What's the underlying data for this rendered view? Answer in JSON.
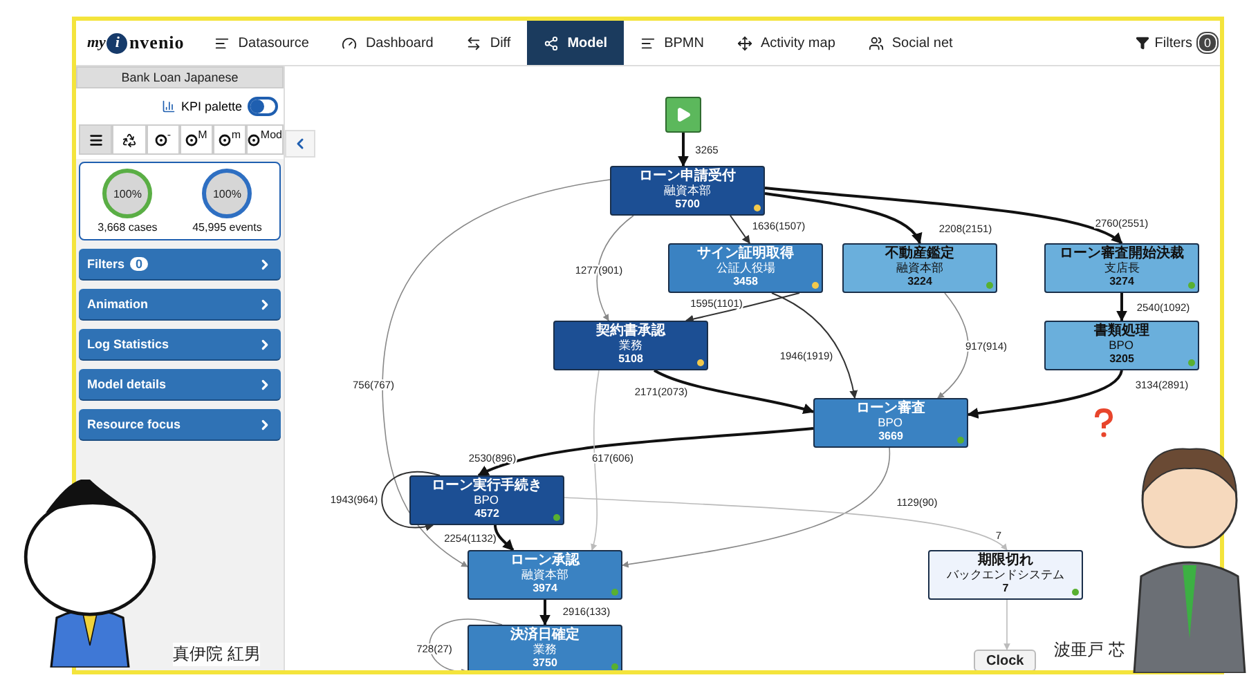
{
  "app": {
    "logo": [
      "my",
      "i",
      "nvenio"
    ]
  },
  "nav": [
    {
      "label": "Datasource",
      "kind": "list",
      "selected": false
    },
    {
      "label": "Dashboard",
      "kind": "gauge",
      "selected": false
    },
    {
      "label": "Diff",
      "kind": "swap",
      "selected": false
    },
    {
      "label": "Model",
      "kind": "model",
      "selected": true
    },
    {
      "label": "BPMN",
      "kind": "list",
      "selected": false
    },
    {
      "label": "Activity map",
      "kind": "move",
      "selected": false
    },
    {
      "label": "Social net",
      "kind": "users",
      "selected": false
    }
  ],
  "filters": {
    "label": "Filters",
    "count": "0"
  },
  "sidebar": {
    "title": "Bank Loan Japanese",
    "kpi_palette": {
      "label": "KPI palette",
      "on": false
    },
    "tools": [
      {
        "kind": "menu",
        "selected": true
      },
      {
        "kind": "recycle",
        "selected": false
      },
      {
        "kind": "dial",
        "label": "-",
        "selected": false
      },
      {
        "kind": "dial",
        "label": "M",
        "selected": false
      },
      {
        "kind": "dial",
        "label": "m",
        "selected": false
      },
      {
        "kind": "dial",
        "label": "Mod",
        "selected": false
      }
    ],
    "stats": [
      {
        "percent": "100%",
        "caption": "3,668 cases",
        "color": "#5aae45"
      },
      {
        "percent": "100%",
        "caption": "45,995 events",
        "color": "#2e6fc2"
      }
    ],
    "panels": [
      {
        "label": "Filters",
        "badge": "0"
      },
      {
        "label": "Animation"
      },
      {
        "label": "Log Statistics"
      },
      {
        "label": "Model details"
      },
      {
        "label": "Resource focus"
      }
    ]
  },
  "process_map": {
    "nodes": [
      {
        "title": "ローン申請受付",
        "resource": "融資本部",
        "count": "5700",
        "kind": "dark",
        "color": "#f2c94c"
      },
      {
        "title": "サイン証明取得",
        "resource": "公証人役場",
        "count": "3458",
        "kind": "medium",
        "color": "#f2c94c"
      },
      {
        "title": "不動産鑑定",
        "resource": "融資本部",
        "count": "3224",
        "kind": "light",
        "color": "#58b030"
      },
      {
        "title": "ローン審査開始決裁",
        "resource": "支店長",
        "count": "3274",
        "kind": "light",
        "color": "#58b030"
      },
      {
        "title": "契約書承認",
        "resource": "業務",
        "count": "5108",
        "kind": "dark",
        "color": "#f2c94c"
      },
      {
        "title": "書類処理",
        "resource": "BPO",
        "count": "3205",
        "kind": "light",
        "color": "#58b030"
      },
      {
        "title": "ローン審査",
        "resource": "BPO",
        "count": "3669",
        "kind": "medium",
        "color": "#58b030"
      },
      {
        "title": "ローン実行手続き",
        "resource": "BPO",
        "count": "4572",
        "kind": "dark",
        "color": "#58b030"
      },
      {
        "title": "ローン承認",
        "resource": "融資本部",
        "count": "3974",
        "kind": "medium",
        "color": "#58b030"
      },
      {
        "title": "期限切れ",
        "resource": "バックエンドシステム",
        "count": "7",
        "kind": "pale",
        "color": "#58b030"
      },
      {
        "title": "決済日確定",
        "resource": "業務",
        "count": "3750",
        "kind": "medium",
        "color": "#58b030"
      }
    ],
    "edges": [
      {
        "label": "3265",
        "kind": "strong"
      },
      {
        "label": "1636(1507)",
        "kind": "normal"
      },
      {
        "label": "2208(2151)",
        "kind": "strong"
      },
      {
        "label": "2760(2551)",
        "kind": "strong"
      },
      {
        "label": "1277(901)",
        "kind": "weak"
      },
      {
        "label": "1595(1101)",
        "kind": "normal"
      },
      {
        "label": "1946(1919)",
        "kind": "normal"
      },
      {
        "label": "917(914)",
        "kind": "weak"
      },
      {
        "label": "2540(1092)",
        "kind": "strong"
      },
      {
        "label": "2171(2073)",
        "kind": "strong"
      },
      {
        "label": "3134(2891)",
        "kind": "strong"
      },
      {
        "label": "756(767)",
        "kind": "weak"
      },
      {
        "label": "2530(896)",
        "kind": "strong"
      },
      {
        "label": "617(606)",
        "kind": "faint"
      },
      {
        "label": "1943(964)",
        "kind": "normal"
      },
      {
        "label": "2254(1132)",
        "kind": "strong"
      },
      {
        "label": "1129(90)",
        "kind": "weak"
      },
      {
        "label": "7",
        "kind": "faint"
      },
      {
        "label": "2916(133)",
        "kind": "strong"
      },
      {
        "label": "728(27)",
        "kind": "weak"
      },
      {
        "kind": "faint"
      }
    ],
    "clock_button": "Clock"
  },
  "characters": [
    {
      "kind": "cartoon",
      "name": "真伊院 紅男"
    },
    {
      "kind": "businessman",
      "name": "波亜戸 芯"
    }
  ]
}
